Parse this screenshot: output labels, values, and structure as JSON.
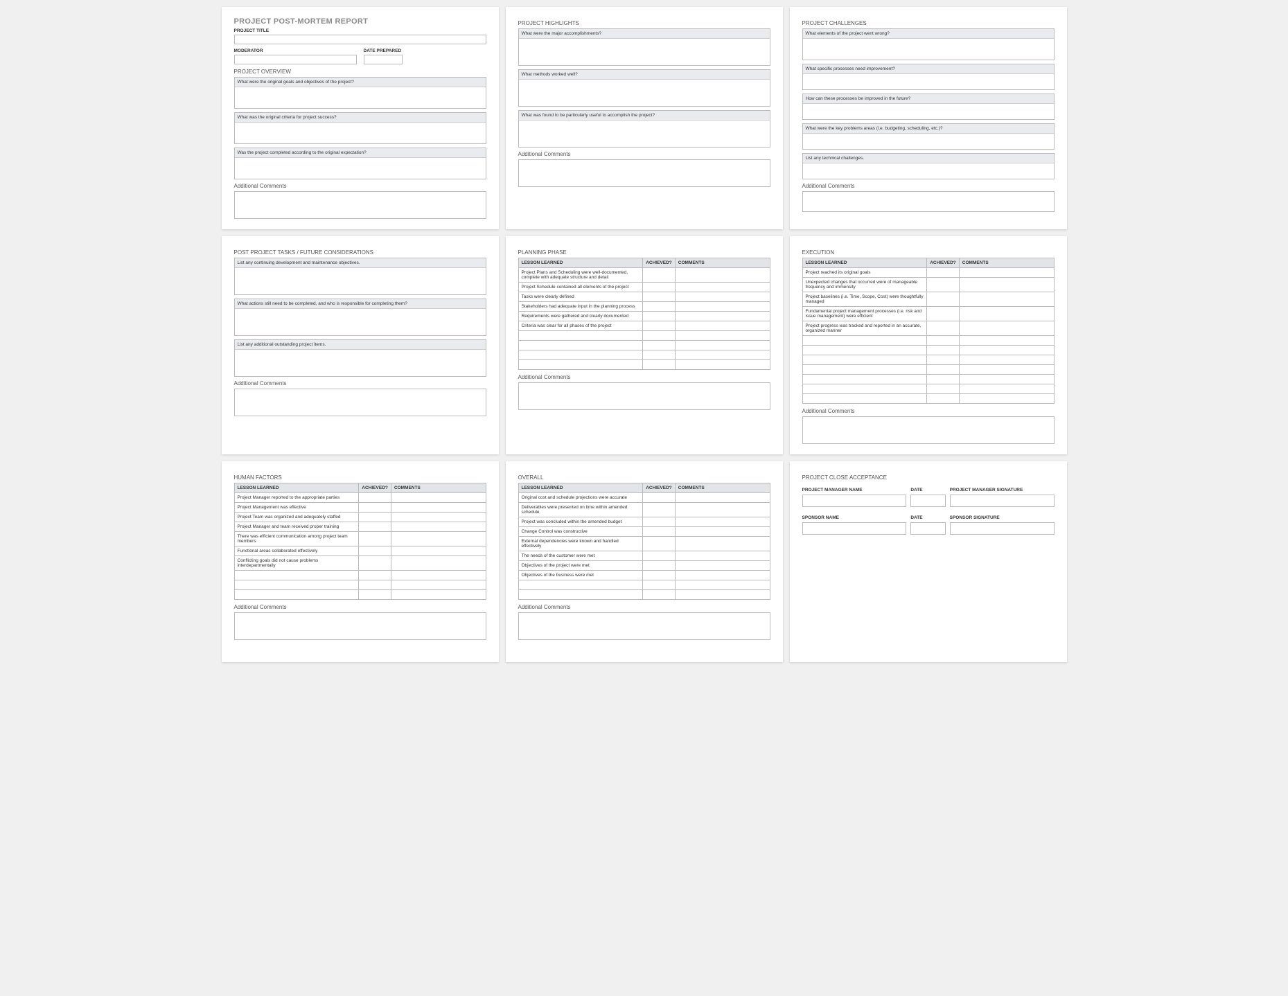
{
  "page1": {
    "title": "PROJECT POST-MORTEM REPORT",
    "project_title_label": "PROJECT TITLE",
    "moderator_label": "MODERATOR",
    "date_prepared_label": "DATE PREPARED",
    "overview_title": "PROJECT OVERVIEW",
    "q1": "What were the original goals and objectives of the project?",
    "q2": "What was the original criteria for project success?",
    "q3": "Was the project completed according to the original expectation?",
    "comments_label": "Additional Comments"
  },
  "page2": {
    "title": "PROJECT HIGHLIGHTS",
    "q1": "What were the major accomplishments?",
    "q2": "What methods worked well?",
    "q3": "What was found to be particularly useful to accomplish the project?",
    "comments_label": "Additional Comments"
  },
  "page3": {
    "title": "PROJECT CHALLENGES",
    "q1": "What elements of the project went wrong?",
    "q2": "What specific processes need improvement?",
    "q3": "How can these processes be improved in the future?",
    "q4": "What were the key problems areas (i.e. budgeting, scheduling, etc.)?",
    "q5": "List any technical challenges.",
    "comments_label": "Additional Comments"
  },
  "page4": {
    "title": "POST PROJECT TASKS / FUTURE CONSIDERATIONS",
    "q1": "List any continuing development and maintenance objectives.",
    "q2": "What actions still need to be completed, and who is responsible for completing them?",
    "q3": "List any additional outstanding project items.",
    "comments_label": "Additional Comments"
  },
  "page5": {
    "title": "PLANNING PHASE",
    "th_lesson": "LESSON LEARNED",
    "th_achieved": "ACHIEVED?",
    "th_comments": "COMMENTS",
    "rows": [
      "Project Plans and Scheduling were well-documented, complete with adequate structure and detail",
      "Project Schedule contained all elements of the project",
      "Tasks were clearly defined",
      "Stakeholders had adequate input in the planning process",
      "Requirements were gathered and clearly documented",
      "Criteria was clear for all phases of the project",
      "",
      "",
      "",
      ""
    ],
    "comments_label": "Additional Comments"
  },
  "page6": {
    "title": "EXECUTION",
    "th_lesson": "LESSON LEARNED",
    "th_achieved": "ACHIEVED?",
    "th_comments": "COMMENTS",
    "rows": [
      "Project reached its original goals",
      "Unexpected changes that occurred were of manageable frequency and immensity",
      "Project baselines (i.e. Time, Scope, Cost) were thoughtfully managed",
      "Fundamental project management processes (i.e. risk and issue management) were efficient",
      "Project progress was tracked and reported in an accurate, organized manner",
      "",
      "",
      "",
      "",
      "",
      "",
      ""
    ],
    "comments_label": "Additional Comments"
  },
  "page7": {
    "title": "HUMAN FACTORS",
    "th_lesson": "LESSON LEARNED",
    "th_achieved": "ACHIEVED?",
    "th_comments": "COMMENTS",
    "rows": [
      "Project Manager reported to the appropriate parties",
      "Project Management was effective",
      "Project Team was organized and adequately staffed",
      "Project Manager and team received proper training",
      "There was efficient communication among project team members",
      "Functional areas collaborated effectively",
      "Conflicting goals did not cause problems interdepartmentally",
      "",
      "",
      ""
    ],
    "comments_label": "Additional Comments"
  },
  "page8": {
    "title": "OVERALL",
    "th_lesson": "LESSON LEARNED",
    "th_achieved": "ACHIEVED?",
    "th_comments": "COMMENTS",
    "rows": [
      "Original cost and schedule projections were accurate",
      "Deliverables were presented on time within amended schedule",
      "Project was concluded within the amended budget",
      "Change Control was constructive",
      "External dependencies were known and handled effectively",
      "The needs of the customer were met",
      "Objectives of the project were met",
      "Objectives of the business were met",
      "",
      ""
    ],
    "comments_label": "Additional Comments"
  },
  "page9": {
    "title": "PROJECT CLOSE ACCEPTANCE",
    "pm_name_label": "PROJECT MANAGER NAME",
    "date_label": "DATE",
    "pm_sig_label": "PROJECT MANAGER SIGNATURE",
    "sponsor_name_label": "SPONSOR NAME",
    "sponsor_sig_label": "SPONSOR SIGNATURE"
  }
}
